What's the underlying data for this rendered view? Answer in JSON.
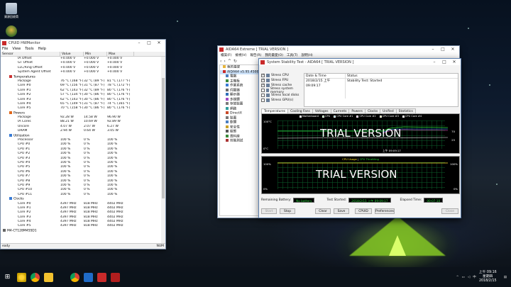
{
  "desktop": {
    "icons": [
      {
        "label": "資源回收筒",
        "icon": "recycle-bin-icon"
      },
      {
        "label": "",
        "icon": "app-shortcut-icon"
      }
    ]
  },
  "hwmonitor": {
    "title": "CPUID HWMonitor",
    "menu": [
      "File",
      "View",
      "Tools",
      "Help"
    ],
    "columns": [
      "Sensor",
      "Value",
      "Min",
      "Max"
    ],
    "rows": [
      {
        "level": 2,
        "name": "IA Offset",
        "value": "+0.000 V",
        "min": "+0.000 V",
        "max": "+0.000 V"
      },
      {
        "level": 2,
        "name": "GT Offset",
        "value": "+0.000 V",
        "min": "+0.000 V",
        "max": "+0.000 V"
      },
      {
        "level": 2,
        "name": "LLC/Ring Offset",
        "value": "+0.000 V",
        "min": "+0.000 V",
        "max": "+0.000 V"
      },
      {
        "level": 2,
        "name": "System Agent Offset",
        "value": "+0.000 V",
        "min": "+0.000 V",
        "max": "+0.000 V"
      },
      {
        "level": 1,
        "name": "Temperatures",
        "value": "",
        "min": "",
        "max": "",
        "group": true,
        "icon": "thermometer-icon"
      },
      {
        "level": 2,
        "name": "Package",
        "value": "76 °C (168 °F)",
        "min": "32 °C (89 °F)",
        "max": "81 °C (177 °F)"
      },
      {
        "level": 2,
        "name": "Core #0",
        "value": "69 °C (156 °F)",
        "min": "31 °C (87 °F)",
        "max": "78 °C (172 °F)"
      },
      {
        "level": 2,
        "name": "Core #1",
        "value": "62 °C (143 °F)",
        "min": "32 °C (89 °F)",
        "max": "80 °C (176 °F)"
      },
      {
        "level": 2,
        "name": "Core #2",
        "value": "57 °C (134 °F)",
        "min": "30 °C (86 °F)",
        "max": "80 °C (176 °F)"
      },
      {
        "level": 2,
        "name": "Core #3",
        "value": "62 °C (143 °F)",
        "min": "30 °C (86 °F)",
        "max": "80 °C (176 °F)"
      },
      {
        "level": 2,
        "name": "Core #4",
        "value": "65 °C (149 °F)",
        "min": "31 °C (87 °F)",
        "max": "74 °C (165 °F)"
      },
      {
        "level": 2,
        "name": "Core #5",
        "value": "70 °C (158 °F)",
        "min": "30 °C (86 °F)",
        "max": "80 °C (176 °F)"
      },
      {
        "level": 1,
        "name": "Powers",
        "value": "",
        "min": "",
        "max": "",
        "group": true,
        "icon": "flame-icon"
      },
      {
        "level": 2,
        "name": "Package",
        "value": "92.28 W",
        "min": "14.58 W",
        "max": "96.90 W"
      },
      {
        "level": 2,
        "name": "IA Cores",
        "value": "88.21 W",
        "min": "10.69 W",
        "max": "92.89 W"
      },
      {
        "level": 2,
        "name": "Uncore",
        "value": "4.07 W",
        "min": "2.07 W",
        "max": "6.27 W"
      },
      {
        "level": 2,
        "name": "DRAM",
        "value": "2.94 W",
        "min": "0.64 W",
        "max": "3.05 W"
      },
      {
        "level": 1,
        "name": "Utilization",
        "value": "",
        "min": "",
        "max": "",
        "group": true,
        "icon": "utilization-icon"
      },
      {
        "level": 2,
        "name": "Processor",
        "value": "100 %",
        "min": "0 %",
        "max": "100 %"
      },
      {
        "level": 2,
        "name": "CPU #0",
        "value": "100 %",
        "min": "0 %",
        "max": "100 %"
      },
      {
        "level": 2,
        "name": "CPU #1",
        "value": "100 %",
        "min": "0 %",
        "max": "100 %"
      },
      {
        "level": 2,
        "name": "CPU #2",
        "value": "100 %",
        "min": "0 %",
        "max": "100 %"
      },
      {
        "level": 2,
        "name": "CPU #3",
        "value": "100 %",
        "min": "0 %",
        "max": "100 %"
      },
      {
        "level": 2,
        "name": "CPU #4",
        "value": "100 %",
        "min": "0 %",
        "max": "100 %"
      },
      {
        "level": 2,
        "name": "CPU #5",
        "value": "100 %",
        "min": "0 %",
        "max": "100 %"
      },
      {
        "level": 2,
        "name": "CPU #6",
        "value": "100 %",
        "min": "0 %",
        "max": "100 %"
      },
      {
        "level": 2,
        "name": "CPU #7",
        "value": "100 %",
        "min": "0 %",
        "max": "100 %"
      },
      {
        "level": 2,
        "name": "CPU #8",
        "value": "100 %",
        "min": "0 %",
        "max": "100 %"
      },
      {
        "level": 2,
        "name": "CPU #9",
        "value": "100 %",
        "min": "0 %",
        "max": "100 %"
      },
      {
        "level": 2,
        "name": "CPU #10",
        "value": "100 %",
        "min": "0 %",
        "max": "100 %"
      },
      {
        "level": 2,
        "name": "CPU #11",
        "value": "100 %",
        "min": "0 %",
        "max": "100 %"
      },
      {
        "level": 1,
        "name": "Clocks",
        "value": "",
        "min": "",
        "max": "",
        "group": true,
        "icon": "clock-icon"
      },
      {
        "level": 2,
        "name": "Core #0",
        "value": "4397 MHz",
        "min": "818 MHz",
        "max": "4402 MHz"
      },
      {
        "level": 2,
        "name": "Core #1",
        "value": "4397 MHz",
        "min": "818 MHz",
        "max": "4402 MHz"
      },
      {
        "level": 2,
        "name": "Core #2",
        "value": "4397 MHz",
        "min": "818 MHz",
        "max": "4402 MHz"
      },
      {
        "level": 2,
        "name": "Core #3",
        "value": "4397 MHz",
        "min": "818 MHz",
        "max": "4402 MHz"
      },
      {
        "level": 2,
        "name": "Core #4",
        "value": "4397 MHz",
        "min": "818 MHz",
        "max": "4402 MHz"
      },
      {
        "level": 2,
        "name": "Core #5",
        "value": "4397 MHz",
        "min": "818 MHz",
        "max": "4402 MHz"
      },
      {
        "level": 0,
        "name": "M4-CT128M4SSD1",
        "value": "",
        "min": "",
        "max": "",
        "group": true,
        "icon": "drive-icon"
      }
    ],
    "status_left": "eady",
    "status_right": "NUM"
  },
  "aida": {
    "title": "AIDA64 Extreme [ TRIAL VERSION ]",
    "menu": [
      "檔案(F)",
      "檢視(V)",
      "報告(R)",
      "我的最愛(O)",
      "工具(T)",
      "說明(H)"
    ],
    "tree": [
      {
        "label": "我的最愛",
        "icon": "favorites-icon"
      },
      {
        "label": "AIDA64 v5.95.4500",
        "icon": "aida64-icon",
        "selected": true
      },
      {
        "label": "電腦",
        "icon": "computer-icon"
      },
      {
        "label": "主機板",
        "icon": "motherboard-icon"
      },
      {
        "label": "作業系統",
        "icon": "os-icon"
      },
      {
        "label": "伺服器",
        "icon": "server-icon"
      },
      {
        "label": "顯示器",
        "icon": "display-icon"
      },
      {
        "label": "多媒體",
        "icon": "multimedia-icon"
      },
      {
        "label": "存放裝置",
        "icon": "storage-icon"
      },
      {
        "label": "網路",
        "icon": "network-icon"
      },
      {
        "label": "DirectX",
        "icon": "directx-icon"
      },
      {
        "label": "裝置",
        "icon": "devices-icon"
      },
      {
        "label": "軟體",
        "icon": "software-icon"
      },
      {
        "label": "安全性",
        "icon": "security-icon"
      },
      {
        "label": "組態",
        "icon": "config-icon"
      },
      {
        "label": "資料庫",
        "icon": "database-icon"
      },
      {
        "label": "效能測試",
        "icon": "benchmark-icon"
      }
    ]
  },
  "stability": {
    "title": "System Stability Test - AIDA64 [ TRIAL VERSION ]",
    "checks": [
      {
        "label": "Stress CPU",
        "checked": true
      },
      {
        "label": "Stress FPU",
        "checked": true
      },
      {
        "label": "Stress cache",
        "checked": true
      },
      {
        "label": "Stress system memory",
        "checked": false
      },
      {
        "label": "Stress local disks",
        "checked": false
      },
      {
        "label": "Stress GPU(s)",
        "checked": false
      }
    ],
    "info_headers": [
      "Date & Time",
      "Status"
    ],
    "info_rows": [
      {
        "date": "2018/2/15 上午 09:09:17",
        "status": "Stability Test: Started"
      }
    ],
    "tabs": [
      "Temperatures",
      "Cooling Fans",
      "Voltages",
      "Currents",
      "Powers",
      "Clocks",
      "Unified",
      "Statistics"
    ],
    "active_tab": "Temperatures",
    "temp_graph": {
      "legend": [
        {
          "label": "Motherboard",
          "color": "#ffffff"
        },
        {
          "label": "CPU",
          "color": "#29d03a"
        },
        {
          "label": "CPU Core #1",
          "color": "#2aa4ff"
        },
        {
          "label": "CPU Core #2",
          "color": "#ff4fd8"
        },
        {
          "label": "CPU Core #3",
          "color": "#ffe02a"
        },
        {
          "label": "CPU Core #4",
          "color": "#ffffff"
        }
      ],
      "y_top": "100°C",
      "y_bottom": "0°C",
      "right_labels": [
        "70",
        "25"
      ],
      "time": "上午 09:09:17",
      "watermark": "TRIAL VERSION"
    },
    "usage_graph": {
      "title_a": "CPU Usage",
      "title_sep": "|",
      "title_b": "CPU Throttling",
      "y_top": "100%",
      "y_bottom": "0%",
      "right_top": "100%",
      "right_bottom": "0%",
      "watermark": "TRIAL VERSION"
    },
    "bottom": {
      "battery_label": "Remaining Battery:",
      "battery_value": "No battery",
      "started_label": "Test Started:",
      "started_value": "2018/2/15 上午 09:09:17",
      "elapsed_label": "Elapsed Time:",
      "elapsed_value": "00:07:10"
    },
    "buttons": [
      "Start",
      "Stop",
      "Clear",
      "Save",
      "CPUID",
      "Preferences",
      "Close"
    ]
  },
  "taskbar": {
    "time": "上午 09:16",
    "weekday": "星期四",
    "date": "2018/2/15",
    "lang": "中"
  },
  "colors": {
    "accent": "#29d03a",
    "graph_grid": "#0b5f2b",
    "tent": "#7fbf25"
  }
}
